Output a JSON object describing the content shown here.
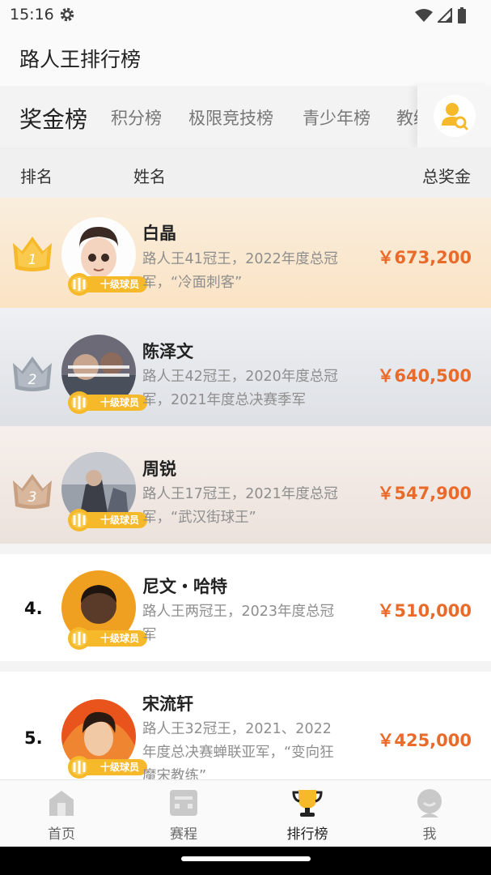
{
  "status": {
    "time": "15:16"
  },
  "app": {
    "title": "路人王排行榜"
  },
  "tabs": [
    {
      "label": "奖金榜",
      "active": true
    },
    {
      "label": "积分榜",
      "active": false
    },
    {
      "label": "极限竞技榜",
      "active": false
    },
    {
      "label": "青少年榜",
      "active": false
    },
    {
      "label": "教练",
      "active": false
    }
  ],
  "columns": {
    "rank": "排名",
    "name": "姓名",
    "prize": "总奖金"
  },
  "badge_label": "十级球员",
  "players": [
    {
      "rank": "1",
      "name": "白晶",
      "desc": "路人王41冠王，2022年度总冠军，“冷面刺客”",
      "prize": "￥673,200"
    },
    {
      "rank": "2",
      "name": "陈泽文",
      "desc": "路人王42冠王，2020年度总冠军，2021年度总决赛季军",
      "prize": "￥640,500"
    },
    {
      "rank": "3",
      "name": "周锐",
      "desc": "路人王17冠王，2021年度总冠军，“武汉街球王”",
      "prize": "￥547,900"
    },
    {
      "rank": "4.",
      "name": "尼文・哈特",
      "desc": "路人王两冠王，2023年度总冠军",
      "prize": "￥510,000"
    },
    {
      "rank": "5.",
      "name": "宋流轩",
      "desc": "路人王32冠王，2021、2022年度总决赛蝉联亚军，“变向狂魔宋教练”",
      "prize": "￥425,000"
    }
  ],
  "nav": [
    {
      "label": "首页",
      "icon": "home-icon",
      "active": false
    },
    {
      "label": "赛程",
      "icon": "schedule-icon",
      "active": false
    },
    {
      "label": "排行榜",
      "icon": "trophy-icon",
      "active": true
    },
    {
      "label": "我",
      "icon": "profile-icon",
      "active": false
    }
  ],
  "colors": {
    "accent": "#f6b61a",
    "prize": "#ea6a2a",
    "gold": "#f5b92a",
    "silver": "#9aa3ad",
    "bronze": "#c8a183"
  }
}
